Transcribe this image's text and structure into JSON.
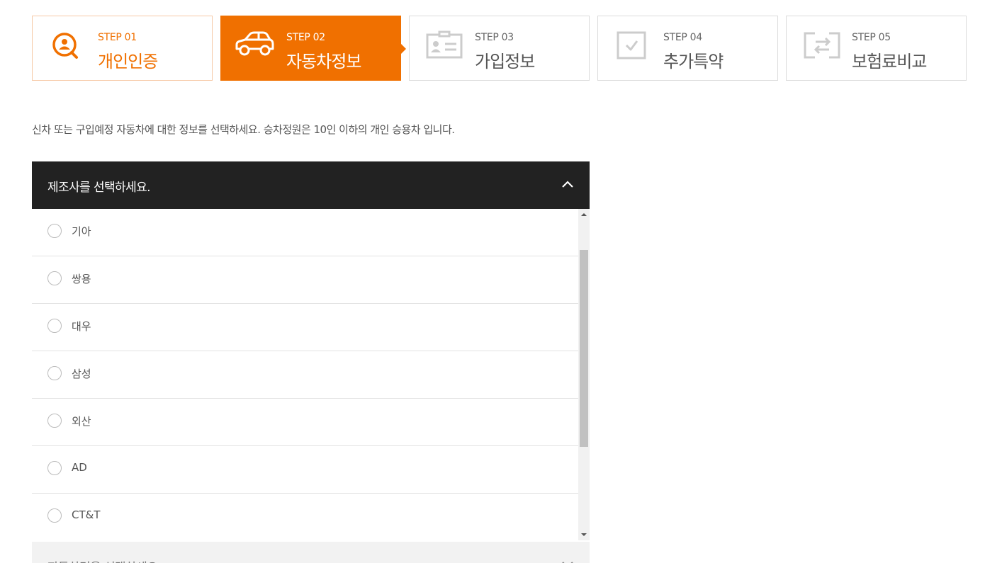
{
  "steps": [
    {
      "num": "STEP 01",
      "title": "개인인증",
      "icon": "search-user-icon",
      "state": "done"
    },
    {
      "num": "STEP 02",
      "title": "자동차정보",
      "icon": "car-icon",
      "state": "active"
    },
    {
      "num": "STEP 03",
      "title": "가입정보",
      "icon": "id-card-icon",
      "state": "pending"
    },
    {
      "num": "STEP 04",
      "title": "추가특약",
      "icon": "checkbox-icon",
      "state": "pending"
    },
    {
      "num": "STEP 05",
      "title": "보험료비교",
      "icon": "compare-icon",
      "state": "pending"
    }
  ],
  "description": "신차 또는 구입예정 자동차에 대한 정보를 선택하세요. 승차정원은 10인 이하의 개인 승용차 입니다.",
  "manufacturer": {
    "placeholder": "제조사를 선택하세요.",
    "options": [
      "기아",
      "쌍용",
      "대우",
      "삼성",
      "외산",
      "AD",
      "CT&T"
    ]
  },
  "car_name": {
    "placeholder": "자동차명을 선택하세요."
  },
  "colors": {
    "accent": "#f07000",
    "header_bg": "#222222"
  }
}
